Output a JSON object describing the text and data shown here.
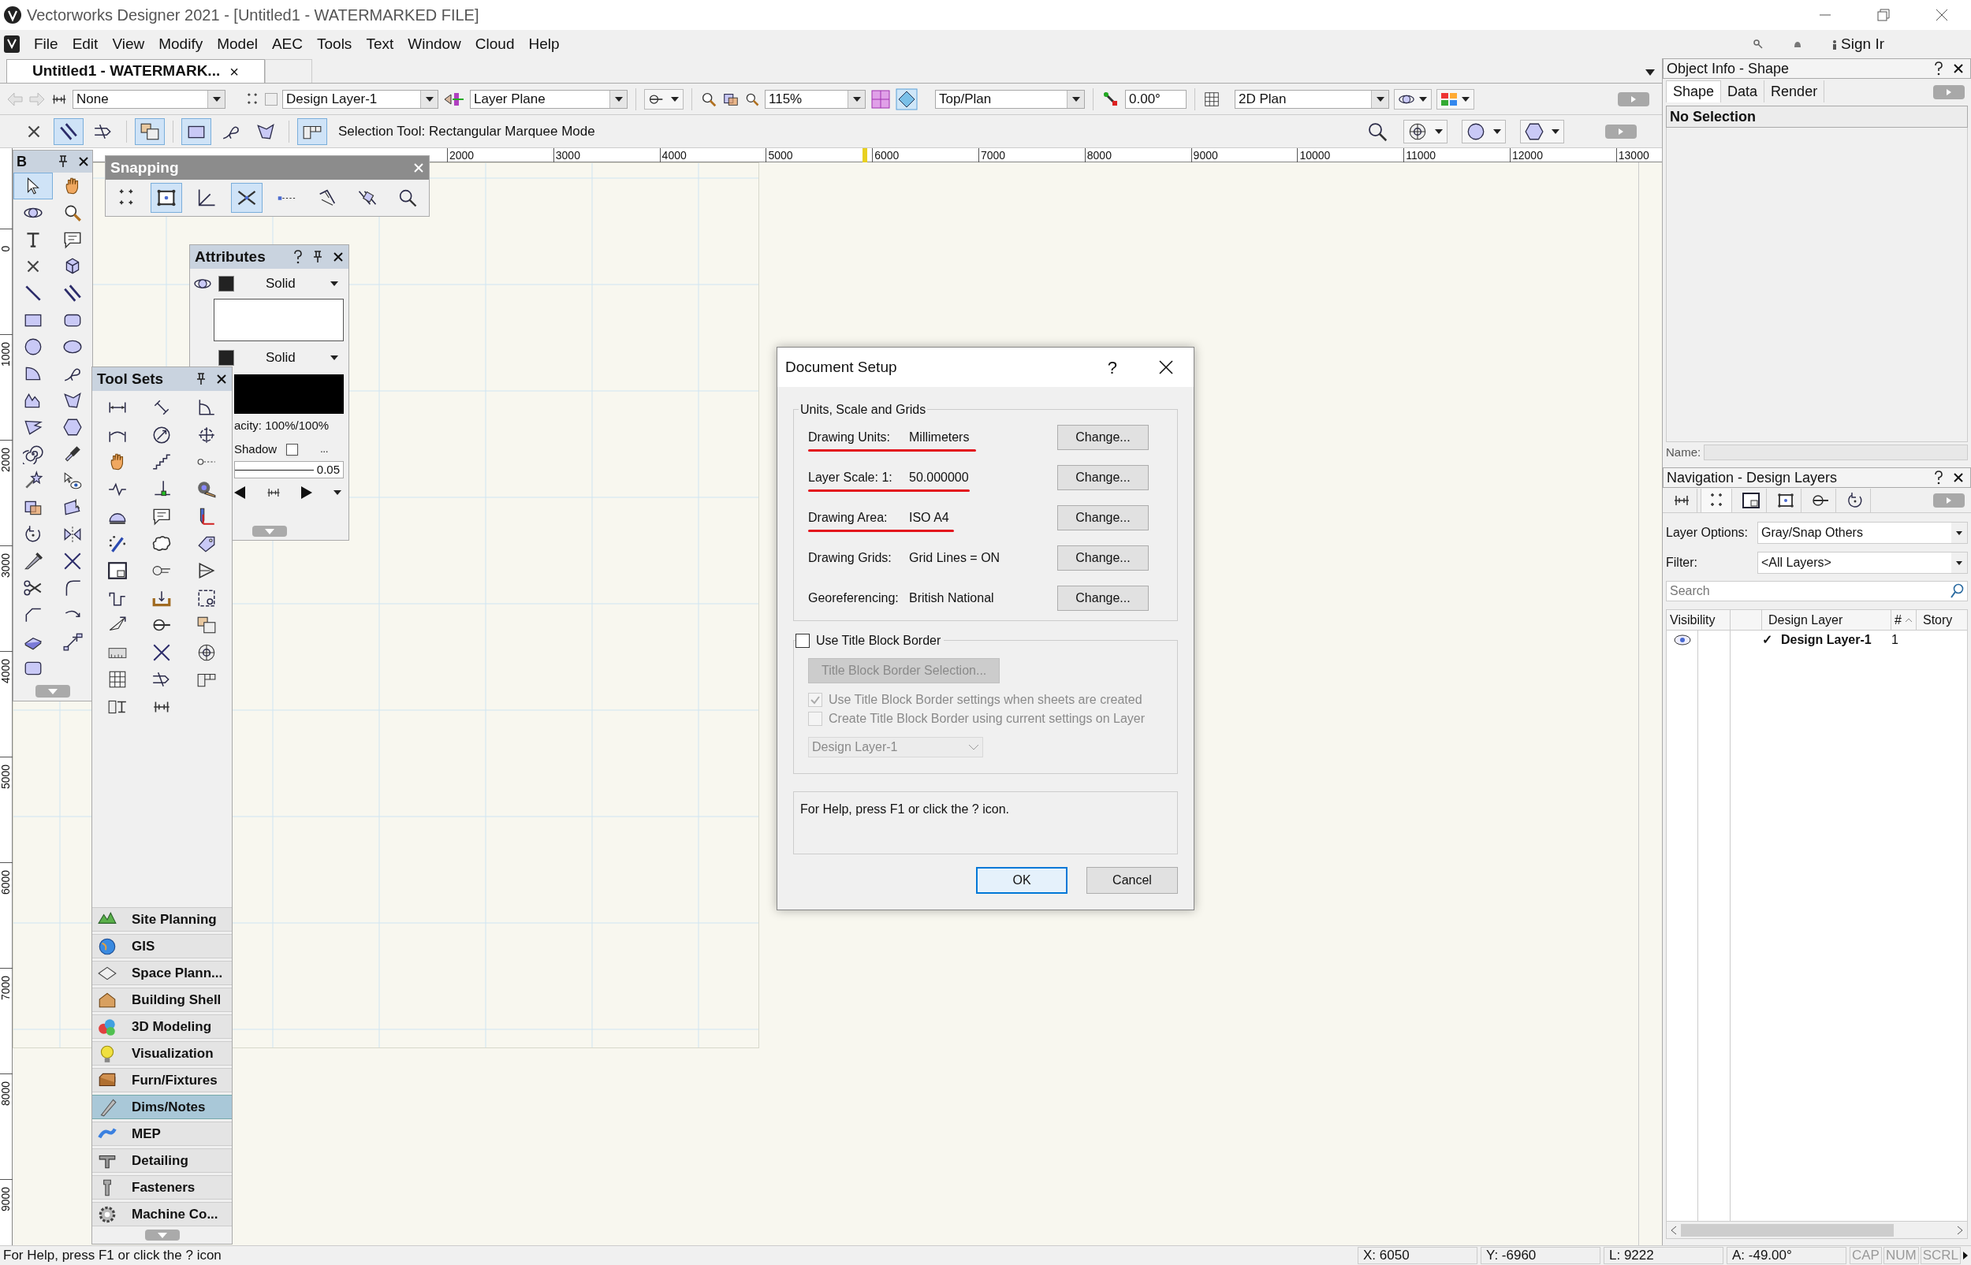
{
  "window": {
    "title": "Vectorworks Designer 2021 - [Untitled1 - WATERMARKED FILE]"
  },
  "menu_bar": {
    "items": [
      "File",
      "Edit",
      "View",
      "Modify",
      "Model",
      "AEC",
      "Tools",
      "Text",
      "Window",
      "Cloud",
      "Help"
    ],
    "account": "Sign Ir"
  },
  "document_tab": {
    "label": "Untitled1 - WATERMARK...",
    "close": "×"
  },
  "view_bar": {
    "class": "None",
    "layer": "Design Layer-1",
    "plane": "Layer Plane",
    "zoom": "115%",
    "view": "Top/Plan",
    "rotation": "0.00°",
    "render_mode": "2D Plan"
  },
  "mode_bar": {
    "modes": [
      {
        "selected": false
      },
      {
        "selected": true
      },
      {
        "selected": false
      },
      {
        "selected": true
      },
      {
        "selected": true
      },
      {
        "selected": false
      },
      {
        "selected": false
      },
      {
        "selected": true
      }
    ],
    "status": "Selection Tool: Rectangular Marquee Mode"
  },
  "rulers": {
    "x_labels": [
      "2000",
      "3000",
      "4000",
      "5000",
      "6000",
      "7000",
      "8000",
      "9000",
      "10000",
      "11000",
      "12000",
      "13000"
    ],
    "y_labels": [
      "0",
      "1000",
      "2000",
      "3000",
      "4000",
      "5000",
      "6000",
      "7000",
      "8000",
      "9000"
    ]
  },
  "basic_palette": {
    "title": "B"
  },
  "snapping_palette": {
    "title": "Snapping",
    "buttons": [
      {
        "selected": false
      },
      {
        "selected": true
      },
      {
        "selected": false
      },
      {
        "selected": true
      },
      {
        "selected": false
      },
      {
        "selected": false
      },
      {
        "selected": false
      },
      {
        "selected": false
      }
    ]
  },
  "attributes_palette": {
    "title": "Attributes",
    "fill_style": "Solid",
    "pen_style": "Solid",
    "opacity": "acity: 100%/100%",
    "shadow": "Shadow",
    "shadow_checked": false,
    "shadow_more": "...",
    "line_weight": "0.05"
  },
  "tool_sets_palette": {
    "title": "Tool Sets",
    "categories": [
      {
        "label": "Site Planning",
        "selected": false
      },
      {
        "label": "GIS",
        "selected": false
      },
      {
        "label": "Space Plann...",
        "selected": false
      },
      {
        "label": "Building Shell",
        "selected": false
      },
      {
        "label": "3D Modeling",
        "selected": false
      },
      {
        "label": "Visualization",
        "selected": false
      },
      {
        "label": "Furn/Fixtures",
        "selected": false
      },
      {
        "label": "Dims/Notes",
        "selected": true
      },
      {
        "label": "MEP",
        "selected": false
      },
      {
        "label": "Detailing",
        "selected": false
      },
      {
        "label": "Fasteners",
        "selected": false
      },
      {
        "label": "Machine Co...",
        "selected": false
      }
    ]
  },
  "dialog": {
    "title": "Document Setup",
    "help": "?",
    "group": "Units, Scale and Grids",
    "settings": [
      {
        "label": "Drawing Units:",
        "value": "Millimeters",
        "button": "Change...",
        "underlined": true
      },
      {
        "label": "Layer Scale:  1:",
        "value": "50.000000",
        "button": "Change...",
        "underlined": true
      },
      {
        "label": "Drawing Area:",
        "value": "ISO A4",
        "button": "Change...",
        "underlined": true
      },
      {
        "label": "Drawing Grids:",
        "value": "Grid Lines = ON",
        "button": "Change...",
        "underlined": false
      },
      {
        "label": "Georeferencing:",
        "value": "British National",
        "button": "Change...",
        "underlined": false
      }
    ],
    "title_block": {
      "label": "Use Title Block Border",
      "checked": false,
      "selection_button": "Title Block Border Selection...",
      "options": [
        {
          "label": "Use Title Block Border settings when sheets are created",
          "checked": true,
          "disabled": true
        },
        {
          "label": "Create Title Block Border using current settings on Layer",
          "checked": false,
          "disabled": true
        }
      ],
      "layer": "Design Layer-1"
    },
    "help_text": "For Help, press F1 or click the ? icon.",
    "buttons": [
      {
        "label": "OK",
        "default": true
      },
      {
        "label": "Cancel",
        "default": false
      }
    ]
  },
  "object_info": {
    "title": "Object Info - Shape",
    "tabs": [
      {
        "label": "Shape",
        "selected": true
      },
      {
        "label": "Data",
        "selected": false
      },
      {
        "label": "Render",
        "selected": false
      }
    ],
    "selection": "No Selection",
    "name_label": "Name:"
  },
  "navigation": {
    "title": "Navigation - Design Layers",
    "tabs": [
      {
        "selected": false
      },
      {
        "selected": true
      },
      {
        "selected": false
      },
      {
        "selected": false
      },
      {
        "selected": false
      },
      {
        "selected": false
      }
    ],
    "layer_options_label": "Layer Options:",
    "layer_options": "Gray/Snap Others",
    "filter_label": "Filter:",
    "filter": "<All Layers>",
    "search": {
      "placeholder": "Search"
    },
    "columns": [
      "Visibility",
      "Design Layer",
      "#",
      "Story"
    ],
    "rows": [
      {
        "visible": true,
        "active": "✓",
        "name": "Design Layer-1",
        "number": "1"
      }
    ]
  },
  "status_bar": {
    "help": "For Help, press F1 or click the ? icon",
    "x": "X: 6050",
    "y": "Y: -6960",
    "length": "L: 9222",
    "angle": "A: -49.00°",
    "keys": [
      {
        "label": "CAP",
        "on": false
      },
      {
        "label": "NUM",
        "on": false
      },
      {
        "label": "SCRL",
        "on": false
      }
    ]
  }
}
